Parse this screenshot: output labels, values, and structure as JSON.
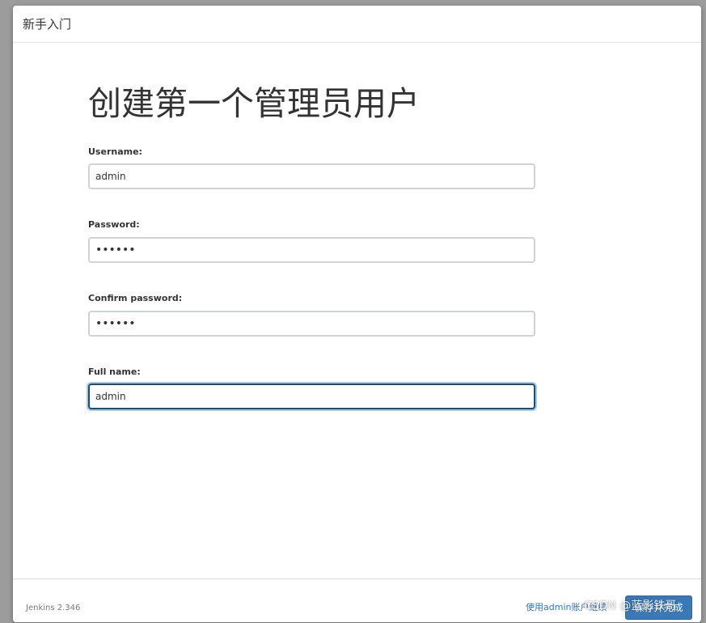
{
  "dialog": {
    "title": "新手入门"
  },
  "form": {
    "heading": "创建第一个管理员用户",
    "fields": [
      {
        "label": "Username:",
        "value": "admin",
        "type": "text",
        "focused": false
      },
      {
        "label": "Password:",
        "value": "••••••",
        "type": "password",
        "focused": false
      },
      {
        "label": "Confirm password:",
        "value": "••••••",
        "type": "password",
        "focused": false
      },
      {
        "label": "Full name:",
        "value": "admin",
        "type": "text",
        "focused": true
      }
    ]
  },
  "footer": {
    "version": "Jenkins 2.346",
    "continue_link": "使用admin账户继续",
    "save_button": "保存并完成"
  },
  "watermark": {
    "text": "CSDN @蓝影铁哥"
  },
  "colors": {
    "primary_button": "#3b78b4",
    "link": "#3a73b0",
    "focus_border": "#1b4f72",
    "focus_glow": "#a7cbe6"
  }
}
